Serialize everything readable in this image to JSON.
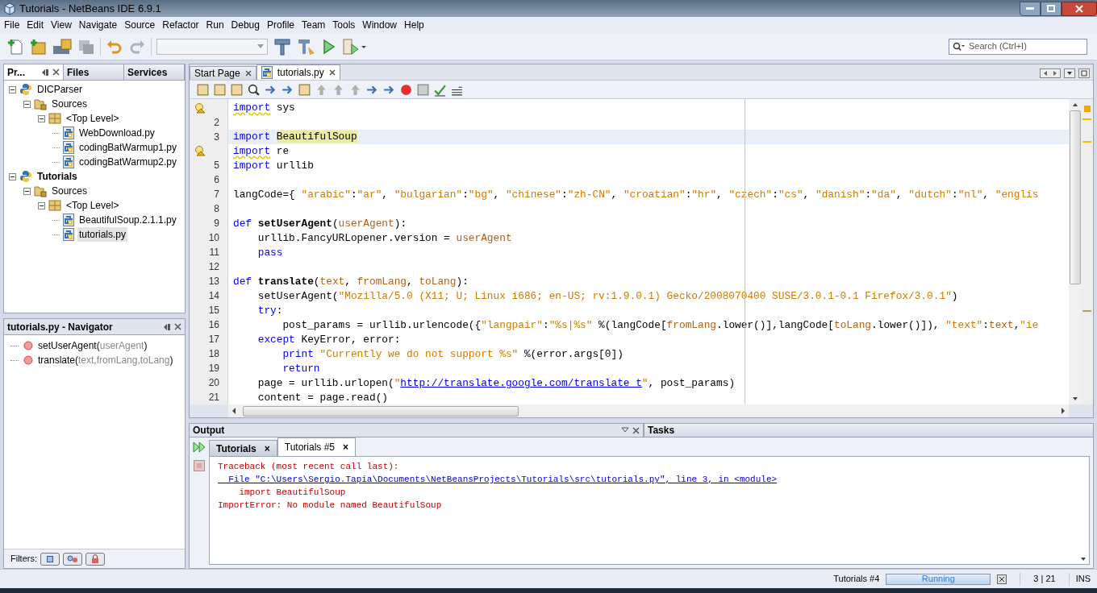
{
  "window": {
    "title": "Tutorials - NetBeans IDE 6.9.1"
  },
  "menu": [
    "File",
    "Edit",
    "View",
    "Navigate",
    "Source",
    "Refactor",
    "Run",
    "Debug",
    "Profile",
    "Team",
    "Tools",
    "Window",
    "Help"
  ],
  "search": {
    "placeholder": "Search (Ctrl+I)"
  },
  "side_tabs": [
    {
      "label": "Pr...",
      "selected": true
    },
    {
      "label": "Files",
      "selected": false
    },
    {
      "label": "Services",
      "selected": false
    }
  ],
  "project_tree": [
    {
      "label": "DICParser",
      "kind": "project",
      "main": false,
      "expanded": true,
      "children": [
        {
          "label": "Sources",
          "kind": "folder",
          "expanded": true,
          "children": [
            {
              "label": "<Top Level>",
              "kind": "package",
              "expanded": true,
              "children": [
                {
                  "label": "WebDownload.py",
                  "kind": "file",
                  "selected": false
                },
                {
                  "label": "codingBatWarmup1.py",
                  "kind": "file",
                  "selected": false
                },
                {
                  "label": "codingBatWarmup2.py",
                  "kind": "file",
                  "selected": false
                }
              ]
            }
          ]
        }
      ]
    },
    {
      "label": "Tutorials",
      "kind": "project",
      "main": true,
      "expanded": true,
      "children": [
        {
          "label": "Sources",
          "kind": "folder",
          "expanded": true,
          "children": [
            {
              "label": "<Top Level>",
              "kind": "package",
              "expanded": true,
              "children": [
                {
                  "label": "BeautifulSoup.2.1.1.py",
                  "kind": "file",
                  "selected": false
                },
                {
                  "label": "tutorials.py",
                  "kind": "file",
                  "selected": true
                }
              ]
            }
          ]
        }
      ]
    }
  ],
  "navigator": {
    "title": "tutorials.py - Navigator",
    "items": [
      {
        "name": "setUserAgent(",
        "params": "userAgent",
        "close": ")"
      },
      {
        "name": "translate(",
        "params": "text,fromLang,toLang",
        "close": ")"
      }
    ],
    "filters_label": "Filters:"
  },
  "editor_tabs": [
    {
      "label": "Start Page",
      "selected": false,
      "file": false
    },
    {
      "label": "tutorials.py",
      "selected": true,
      "file": true
    }
  ],
  "filters": [
    {
      "on": false
    },
    {
      "on": false
    },
    {
      "on": false
    }
  ],
  "code_lines": [
    {
      "warning": true,
      "current": false,
      "segments": [
        {
          "kind": "keyword",
          "text": "import"
        },
        {
          "kind": "plain",
          "text": " sys"
        }
      ]
    },
    {
      "number": "2",
      "warning": false,
      "current": false
    },
    {
      "number": "3",
      "warning": false,
      "current": true,
      "segments": [
        {
          "kind": "keyword",
          "text": "import"
        },
        {
          "kind": "highlight",
          "text": " BeautifulSoup"
        }
      ]
    },
    {
      "warning": true,
      "current": false,
      "segments": [
        {
          "kind": "keyword",
          "text": "import"
        },
        {
          "kind": "plain",
          "text": " re"
        }
      ]
    },
    {
      "number": "5",
      "warning": false,
      "current": false,
      "segments": [
        {
          "kind": "keyword",
          "text": "import"
        },
        {
          "kind": "plain",
          "text": " urllib"
        }
      ]
    },
    {
      "number": "6",
      "warning": false,
      "current": false
    },
    {
      "number": "7",
      "warning": false,
      "current": false,
      "segments": [
        {
          "kind": "plain",
          "text": "langCode={ "
        },
        {
          "kind": "string",
          "text": "\"arabic\""
        },
        {
          "kind": "plain",
          "text": ":"
        },
        {
          "kind": "string",
          "text": "\"ar\""
        },
        {
          "kind": "plain",
          "text": ", "
        },
        {
          "kind": "string",
          "text": "\"bulgarian\""
        },
        {
          "kind": "plain",
          "text": ":"
        },
        {
          "kind": "string",
          "text": "\"bg\""
        },
        {
          "kind": "plain",
          "text": ", "
        },
        {
          "kind": "string",
          "text": "\"chinese\""
        },
        {
          "kind": "plain",
          "text": ":"
        },
        {
          "kind": "string",
          "text": "\"zh-CN\""
        },
        {
          "kind": "plain",
          "text": ", "
        },
        {
          "kind": "string",
          "text": "\"croatian\""
        },
        {
          "kind": "plain",
          "text": ":"
        },
        {
          "kind": "string",
          "text": "\"hr\""
        },
        {
          "kind": "plain",
          "text": ", "
        },
        {
          "kind": "string",
          "text": "\"czech\""
        },
        {
          "kind": "plain",
          "text": ":"
        },
        {
          "kind": "string",
          "text": "\"cs\""
        },
        {
          "kind": "plain",
          "text": ", "
        },
        {
          "kind": "string",
          "text": "\"danish\""
        },
        {
          "kind": "plain",
          "text": ":"
        },
        {
          "kind": "string",
          "text": "\"da\""
        },
        {
          "kind": "plain",
          "text": ", "
        },
        {
          "kind": "string",
          "text": "\"dutch\""
        },
        {
          "kind": "plain",
          "text": ":"
        },
        {
          "kind": "string",
          "text": "\"nl\""
        },
        {
          "kind": "plain",
          "text": ", "
        },
        {
          "kind": "string",
          "text": "\"englis"
        }
      ]
    },
    {
      "number": "8",
      "warning": false,
      "current": false
    },
    {
      "number": "9",
      "warning": false,
      "current": false,
      "segments": [
        {
          "kind": "keyword",
          "text": "def"
        },
        {
          "kind": "name",
          "text": " setUserAgent"
        },
        {
          "kind": "plain",
          "text": "("
        },
        {
          "kind": "param",
          "text": "userAgent"
        },
        {
          "kind": "plain",
          "text": "):"
        }
      ]
    },
    {
      "number": "10",
      "warning": false,
      "current": false,
      "segments": [
        {
          "kind": "plain",
          "text": "    urllib.FancyURLopener.version = "
        },
        {
          "kind": "param",
          "text": "userAgent"
        }
      ]
    },
    {
      "number": "11",
      "warning": false,
      "current": false,
      "segments": [
        {
          "kind": "keyword",
          "text": "    pass"
        }
      ]
    },
    {
      "number": "12",
      "warning": false,
      "current": false
    },
    {
      "number": "13",
      "warning": false,
      "current": false,
      "segments": [
        {
          "kind": "keyword",
          "text": "def"
        },
        {
          "kind": "name",
          "text": " translate"
        },
        {
          "kind": "plain",
          "text": "("
        },
        {
          "kind": "param",
          "text": "text"
        },
        {
          "kind": "plain",
          "text": ", "
        },
        {
          "kind": "param",
          "text": "fromLang"
        },
        {
          "kind": "plain",
          "text": ", "
        },
        {
          "kind": "param",
          "text": "toLang"
        },
        {
          "kind": "plain",
          "text": "):"
        }
      ]
    },
    {
      "number": "14",
      "warning": false,
      "current": false,
      "segments": [
        {
          "kind": "plain",
          "text": "    setUserAgent("
        },
        {
          "kind": "string",
          "text": "\"Mozilla/5.0 (X11; U; Linux i686; en-US; rv:1.9.0.1) Gecko/2008070400 SUSE/3.0.1-0.1 Firefox/3.0.1\""
        },
        {
          "kind": "plain",
          "text": ")"
        }
      ]
    },
    {
      "number": "15",
      "warning": false,
      "current": false,
      "segments": [
        {
          "kind": "keyword",
          "text": "    try"
        },
        {
          "kind": "plain",
          "text": ":"
        }
      ]
    },
    {
      "number": "16",
      "warning": false,
      "current": false,
      "segments": [
        {
          "kind": "plain",
          "text": "        post_params = urllib.urlencode({"
        },
        {
          "kind": "string",
          "text": "\"langpair\""
        },
        {
          "kind": "plain",
          "text": ":"
        },
        {
          "kind": "string",
          "text": "\"%s|%s\""
        },
        {
          "kind": "plain",
          "text": " %(langCode["
        },
        {
          "kind": "param",
          "text": "fromLang"
        },
        {
          "kind": "plain",
          "text": ".lower()],langCode["
        },
        {
          "kind": "param",
          "text": "toLang"
        },
        {
          "kind": "plain",
          "text": ".lower()]), "
        },
        {
          "kind": "string",
          "text": "\"text\""
        },
        {
          "kind": "plain",
          "text": ":"
        },
        {
          "kind": "param",
          "text": "text"
        },
        {
          "kind": "plain",
          "text": ","
        },
        {
          "kind": "string",
          "text": "\"ie"
        }
      ]
    },
    {
      "number": "17",
      "warning": false,
      "current": false,
      "segments": [
        {
          "kind": "keyword",
          "text": "    except"
        },
        {
          "kind": "plain",
          "text": " KeyError, error:"
        }
      ]
    },
    {
      "number": "18",
      "warning": false,
      "current": false,
      "segments": [
        {
          "kind": "keyword",
          "text": "        print"
        },
        {
          "kind": "string",
          "text": " \"Currently we do not support %s\""
        },
        {
          "kind": "plain",
          "text": " %(error.args[0])"
        }
      ]
    },
    {
      "number": "19",
      "warning": false,
      "current": false,
      "segments": [
        {
          "kind": "keyword",
          "text": "        return"
        }
      ]
    },
    {
      "number": "20",
      "warning": false,
      "current": false,
      "segments": [
        {
          "kind": "plain",
          "text": "    page = urllib.urlopen("
        },
        {
          "kind": "string",
          "text": "\""
        },
        {
          "kind": "link",
          "text": "http://translate.google.com/translate_t"
        },
        {
          "kind": "string",
          "text": "\""
        },
        {
          "kind": "plain",
          "text": ", post_params)"
        }
      ]
    },
    {
      "number": "21",
      "warning": false,
      "current": false,
      "segments": [
        {
          "kind": "plain",
          "text": "    content = page.read()"
        }
      ]
    }
  ],
  "output": {
    "title": "Output",
    "tasks_title": "Tasks",
    "tabs": [
      {
        "label": "Tutorials",
        "selected": false,
        "close": "×"
      },
      {
        "label": "Tutorials #5",
        "selected": true,
        "close": "×"
      }
    ],
    "lines": [
      {
        "kind": "error",
        "text": "Traceback (most recent call last):"
      },
      {
        "kind": "link",
        "text": "  File \"C:\\Users\\Sergio.Tapia\\Documents\\NetBeansProjects\\Tutorials\\src\\tutorials.py\", line 3, in <module>"
      },
      {
        "kind": "error",
        "text": "    import BeautifulSoup"
      },
      {
        "kind": "error",
        "text": "ImportError: No module named BeautifulSoup"
      }
    ]
  },
  "status_bar": {
    "task": "Tutorials #4",
    "progress": {
      "label": "Running",
      "level": 1
    },
    "position": "3 | 21",
    "mode": "INS"
  }
}
